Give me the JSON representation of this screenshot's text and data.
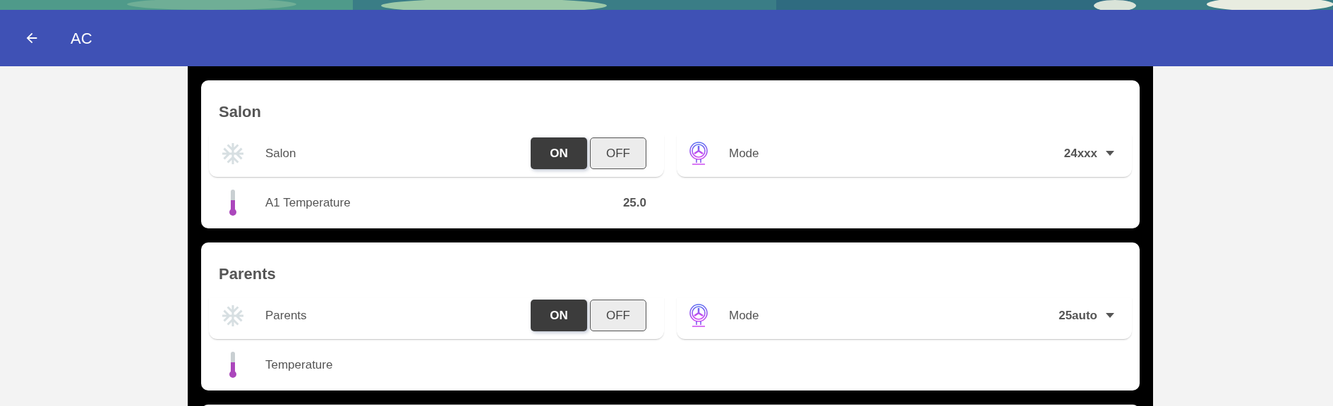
{
  "app_bar": {
    "title": "AC"
  },
  "cards": [
    {
      "title": "Salon",
      "entities": [
        {
          "kind": "switch",
          "name": "Salon",
          "buttons": [
            {
              "label": "ON",
              "selected": true
            },
            {
              "label": "OFF",
              "selected": false
            }
          ]
        },
        {
          "kind": "select",
          "name": "Mode",
          "value": "24xxx"
        },
        {
          "kind": "sensor",
          "name": "A1 Temperature",
          "value": "25.0"
        }
      ]
    },
    {
      "title": "Parents",
      "entities": [
        {
          "kind": "switch",
          "name": "Parents",
          "buttons": [
            {
              "label": "ON",
              "selected": true
            },
            {
              "label": "OFF",
              "selected": false
            }
          ]
        },
        {
          "kind": "select",
          "name": "Mode",
          "value": "25auto"
        },
        {
          "kind": "sensor",
          "name": "Temperature"
        }
      ]
    }
  ]
}
